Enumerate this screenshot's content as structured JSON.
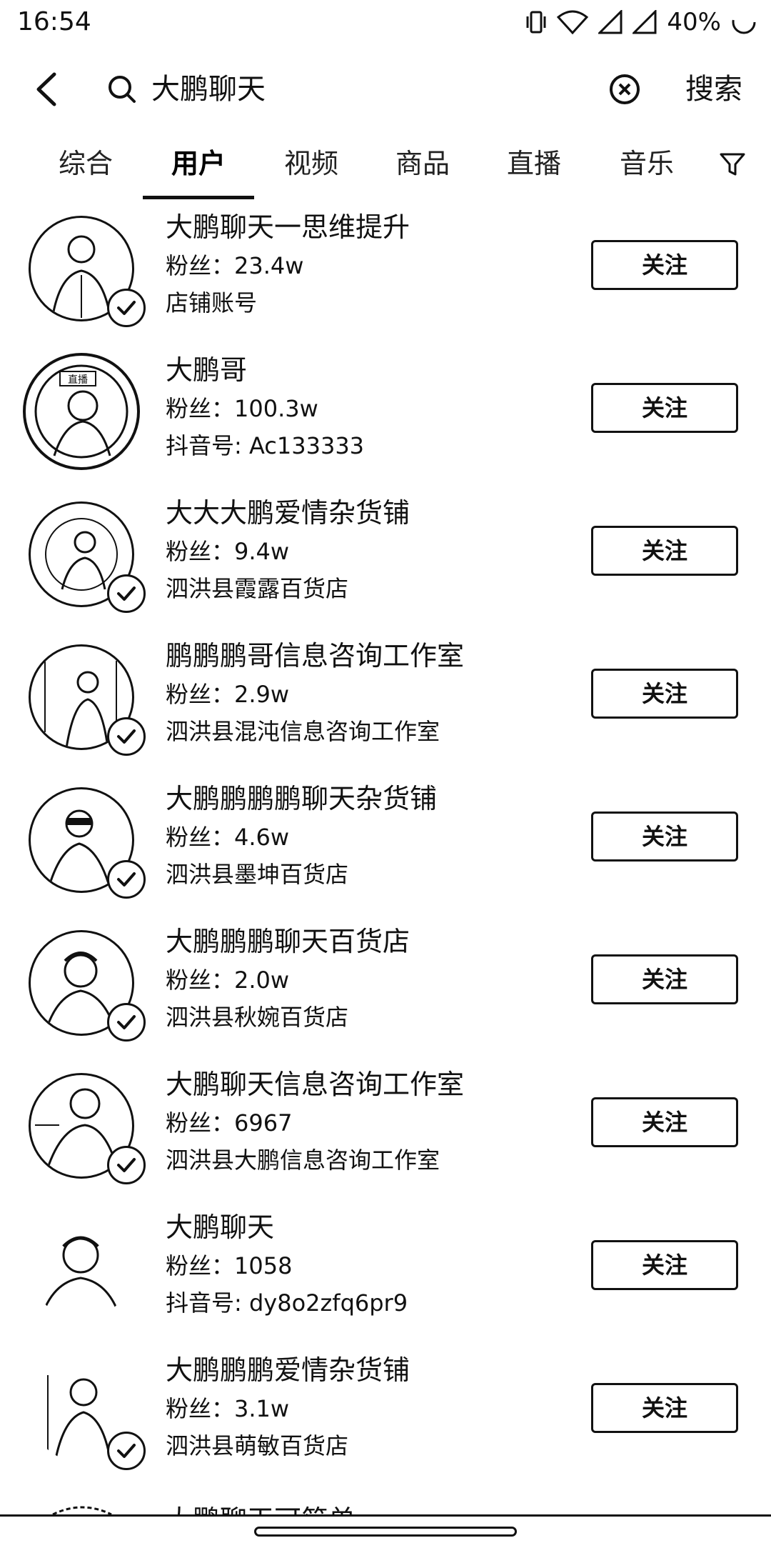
{
  "status_bar": {
    "time": "16:54",
    "battery": "40%",
    "icons": [
      "vibrate-icon",
      "wifi-icon",
      "signal-icon",
      "signal-icon",
      "battery-icon"
    ]
  },
  "search": {
    "query": "大鹏聊天",
    "search_label": "搜索"
  },
  "tabs": [
    {
      "label": "综合",
      "active": false
    },
    {
      "label": "用户",
      "active": true
    },
    {
      "label": "视频",
      "active": false
    },
    {
      "label": "商品",
      "active": false
    },
    {
      "label": "直播",
      "active": false
    },
    {
      "label": "音乐",
      "active": false
    }
  ],
  "users": [
    {
      "name": "大鹏聊天一思维提升",
      "fans": "粉丝：23.4w",
      "sub": "店铺账号",
      "verified": true,
      "follow": "关注"
    },
    {
      "name": "大鹏哥",
      "fans": "粉丝：100.3w",
      "sub": "抖音号: Ac133333",
      "verified": false,
      "live": true,
      "live_label": "直播",
      "follow": "关注"
    },
    {
      "name": "大大大鹏爱情杂货铺",
      "fans": "粉丝：9.4w",
      "sub": "泗洪县霞露百货店",
      "verified": true,
      "follow": "关注"
    },
    {
      "name": "鹏鹏鹏哥信息咨询工作室",
      "fans": "粉丝：2.9w",
      "sub": "泗洪县混沌信息咨询工作室",
      "verified": true,
      "follow": "关注"
    },
    {
      "name": "大鹏鹏鹏鹏聊天杂货铺",
      "fans": "粉丝：4.6w",
      "sub": "泗洪县墨坤百货店",
      "verified": true,
      "follow": "关注"
    },
    {
      "name": "大鹏鹏鹏聊天百货店",
      "fans": "粉丝：2.0w",
      "sub": "泗洪县秋婉百货店",
      "verified": true,
      "follow": "关注"
    },
    {
      "name": "大鹏聊天信息咨询工作室",
      "fans": "粉丝：6967",
      "sub": "泗洪县大鹏信息咨询工作室",
      "verified": true,
      "follow": "关注"
    },
    {
      "name": "大鹏聊天",
      "fans": "粉丝：1058",
      "sub": "抖音号: dy8o2zfq6pr9",
      "verified": false,
      "follow": "关注"
    },
    {
      "name": "大鹏鹏鹏爱情杂货铺",
      "fans": "粉丝：3.1w",
      "sub": "泗洪县萌敏百货店",
      "verified": true,
      "follow": "关注"
    }
  ],
  "partial_row": {
    "name": "大鹏聊天可简单"
  }
}
